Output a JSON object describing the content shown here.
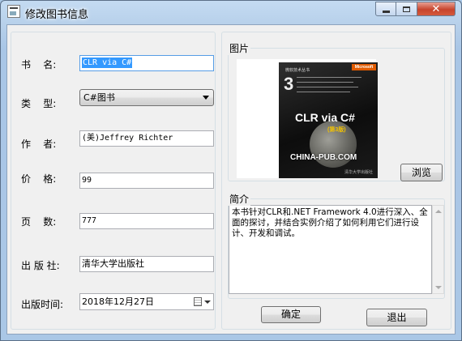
{
  "window": {
    "title": "修改图书信息",
    "close_glyph": "✕"
  },
  "form": {
    "book_name": {
      "label": "书    名:",
      "value": "CLR via C#"
    },
    "category": {
      "label": "类    型:",
      "value": "C#图书"
    },
    "author": {
      "label": "作    者:",
      "value": "(美)Jeffrey Richter"
    },
    "price": {
      "label": "价    格:",
      "value": "99"
    },
    "pages": {
      "label": "页    数:",
      "value": "777"
    },
    "publisher": {
      "label": "出 版 社:",
      "value": "清华大学出版社"
    },
    "publish_date": {
      "label": "出版时间:",
      "value": "2018年12月27日"
    }
  },
  "picture": {
    "group_title": "图片",
    "browse_label": "浏览",
    "cover": {
      "series": "微软技术丛书",
      "publisher_logo": "Microsoft",
      "number": "3",
      "title": "CLR via C#",
      "edition": "(第3版)",
      "watermark": "CHINA-PUB.COM",
      "press": "清华大学出版社"
    }
  },
  "intro": {
    "group_title": "简介",
    "text": "本书针对CLR和.NET Framework 4.0进行深入、全面的探讨，并结合实例介绍了如何利用它们进行设计、开发和调试。"
  },
  "buttons": {
    "ok_label": "确定",
    "exit_label": "退出"
  }
}
